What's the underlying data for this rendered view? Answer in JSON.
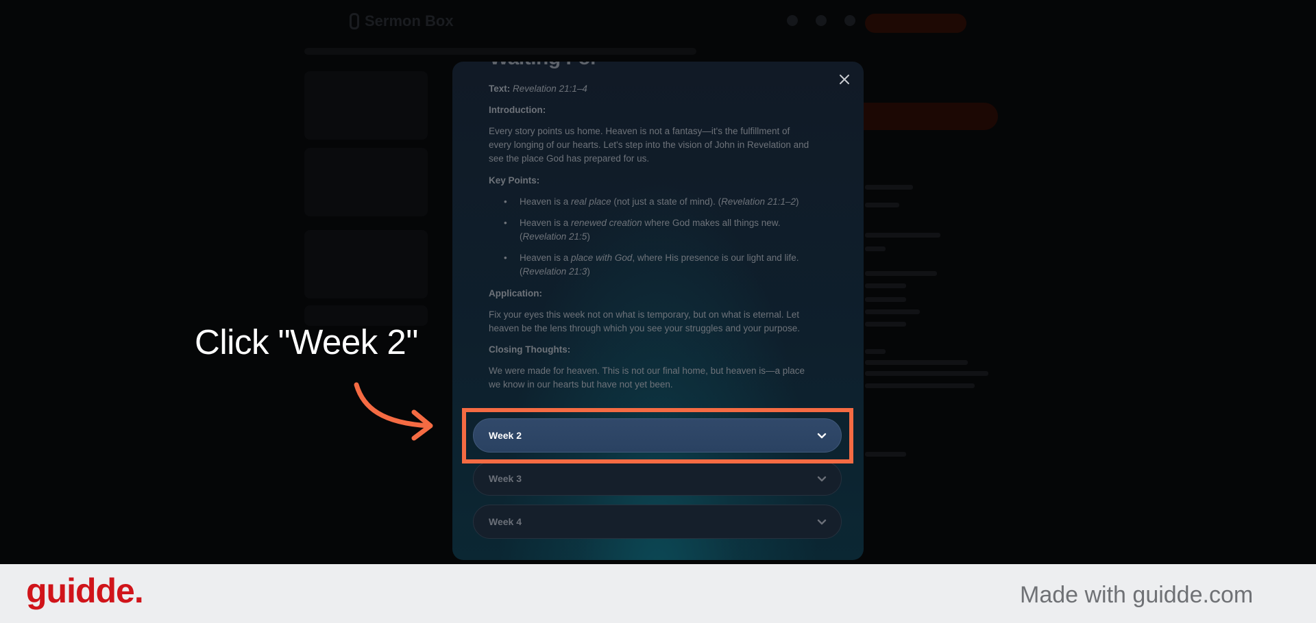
{
  "app": {
    "logo_text": "Sermon Box"
  },
  "modal": {
    "title": "Waiting For",
    "text_label": "Text:",
    "text_ref": "Revelation 21:1–4",
    "introduction_label": "Introduction:",
    "introduction_body": "Every story points us home. Heaven is not a fantasy—it's the fulfillment of every longing of our hearts. Let's step into the vision of John in Revelation and see the place God has prepared for us.",
    "key_points_label": "Key Points:",
    "key_points": [
      {
        "before": "Heaven is a ",
        "em": "real place",
        "after": " (not just a state of mind). (",
        "ref": "Revelation 21:1–2",
        "close": ")"
      },
      {
        "before": "Heaven is a ",
        "em": "renewed creation",
        "after": " where God makes all things new. (",
        "ref": "Revelation 21:5",
        "close": ")"
      },
      {
        "before": "Heaven is a ",
        "em": "place with God",
        "after": ", where His presence is our light and life. (",
        "ref": "Revelation 21:3",
        "close": ")"
      }
    ],
    "application_label": "Application:",
    "application_body": "Fix your eyes this week not on what is temporary, but on what is eternal. Let heaven be the lens through which you see your struggles and your purpose.",
    "closing_label": "Closing Thoughts:",
    "closing_body": "We were made for heaven. This is not our final home, but heaven is—a place we know in our hearts but have not yet been.",
    "weeks": [
      {
        "label": "Week 2",
        "active": true
      },
      {
        "label": "Week 3",
        "active": false
      },
      {
        "label": "Week 4",
        "active": false
      }
    ]
  },
  "guide": {
    "callout": "Click \"Week 2\""
  },
  "footer": {
    "brand": "guidde.",
    "made_with": "Made with guidde.com"
  },
  "colors": {
    "highlight": "#f56b43",
    "brand": "#d0141a",
    "active_accordion": "#31496a"
  },
  "icons": {
    "close": "close-icon",
    "chevron": "chevron-down-icon",
    "arrow": "curved-arrow-icon"
  }
}
